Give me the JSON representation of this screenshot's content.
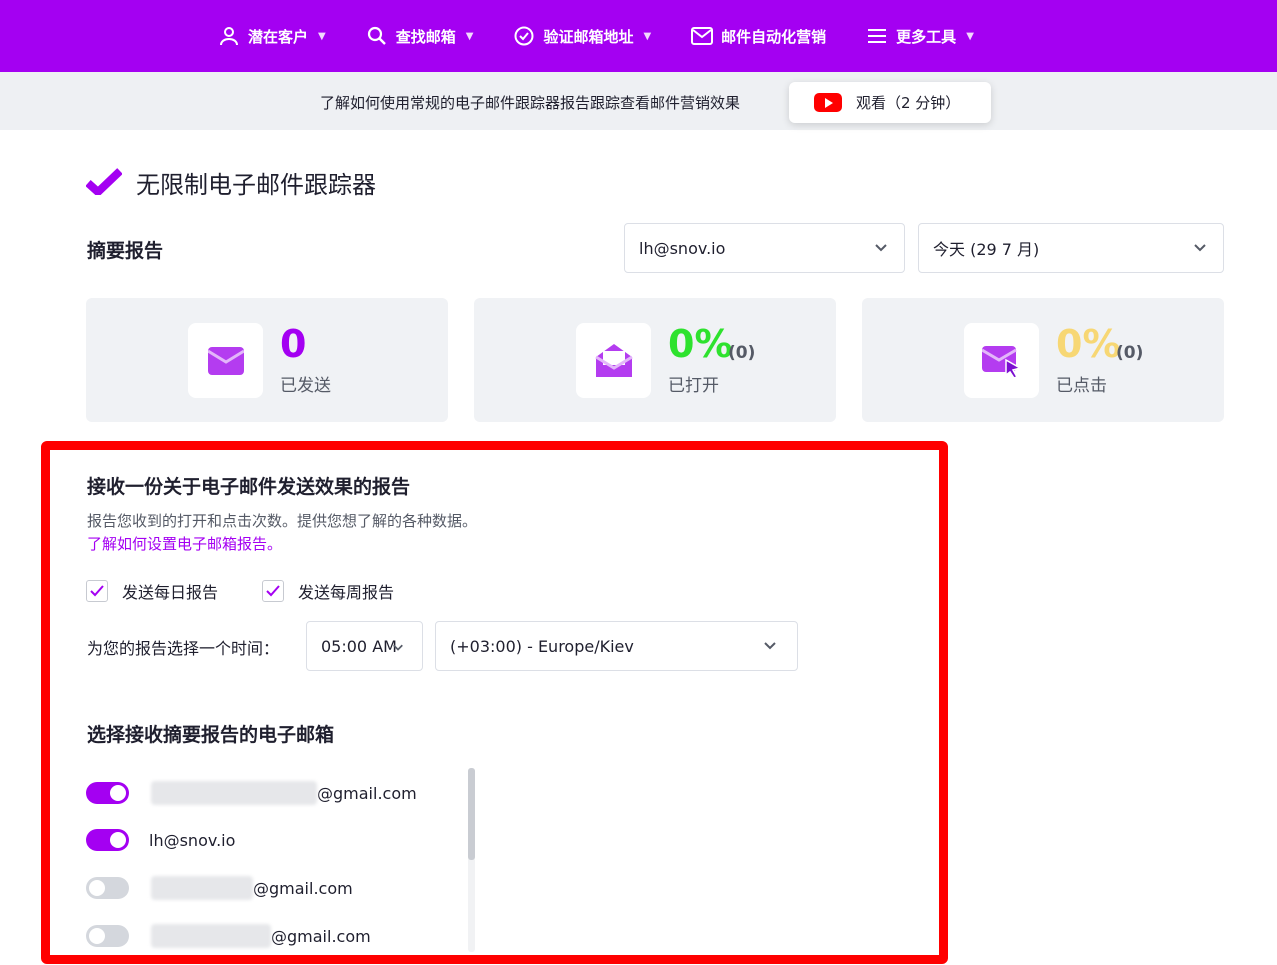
{
  "nav": {
    "items": [
      {
        "label": "潜在客户",
        "icon": "user-icon",
        "has_caret": true
      },
      {
        "label": "查找邮箱",
        "icon": "search-icon",
        "has_caret": true
      },
      {
        "label": "验证邮箱地址",
        "icon": "check-circle-icon",
        "has_caret": true
      },
      {
        "label": "邮件自动化营销",
        "icon": "mail-icon",
        "has_caret": false
      },
      {
        "label": "更多工具",
        "icon": "menu-icon",
        "has_caret": true
      }
    ]
  },
  "promo": {
    "text": "了解如何使用常规的电子邮件跟踪器报告跟踪查看邮件营销效果",
    "watch_label": "观看（2 分钟）"
  },
  "page": {
    "title": "无限制电子邮件跟踪器",
    "summary_title": "摘要报告",
    "account_select": "lh@snov.io",
    "date_select": "今天 (29 7 月)"
  },
  "stats": [
    {
      "value": "0",
      "count": "",
      "label": "已发送",
      "color": "#a400f2",
      "icon": "envelope-icon"
    },
    {
      "value": "0%",
      "count": "(0)",
      "label": "已打开",
      "color": "#2ee22e",
      "icon": "open-envelope-icon"
    },
    {
      "value": "0%",
      "count": "(0)",
      "label": "已点击",
      "color": "#f7d774",
      "icon": "envelope-click-icon"
    }
  ],
  "report": {
    "title": "接收一份关于电子邮件发送效果的报告",
    "desc": "报告您收到的打开和点击次数。提供您想了解的各种数据。",
    "link": "了解如何设置电子邮箱报告。",
    "daily_label": "发送每日报告",
    "weekly_label": "发送每周报告",
    "daily_checked": true,
    "weekly_checked": true,
    "time_label": "为您的报告选择一个时间：",
    "time_value": "05:00 AM",
    "timezone_value": "(+03:00) - Europe/Kiev",
    "emails_title": "选择接收摘要报告的电子邮箱",
    "emails": [
      {
        "suffix": "@gmail.com",
        "on": true,
        "blurred": true
      },
      {
        "suffix": "lh@snov.io",
        "on": true,
        "blurred": false
      },
      {
        "suffix": "@gmail.com",
        "on": false,
        "blurred": true
      },
      {
        "suffix": "@gmail.com",
        "on": false,
        "blurred": true
      }
    ]
  },
  "colors": {
    "brand": "#a400f2",
    "highlight": "#ff0000"
  }
}
